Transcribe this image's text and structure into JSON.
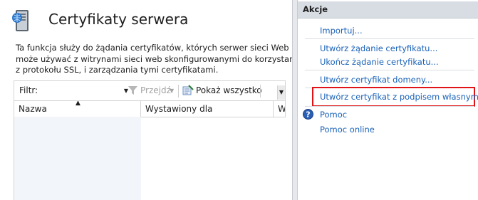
{
  "page": {
    "title": "Certyfikaty serwera",
    "description_lines": [
      "Ta funkcja służy do żądania certyfikatów, których serwer sieci Web",
      "może używać z witrynami sieci web skonfigurowanymi do korzystania",
      "z protokołu SSL, i zarządzania tymi certyfikatami."
    ]
  },
  "filter_bar": {
    "label": "Filtr:",
    "value": "",
    "go_label": "Przejdź",
    "show_all_label": "Pokaż wszystko"
  },
  "grid": {
    "columns": [
      "Nazwa",
      "Wystawiony dla",
      "Wy"
    ],
    "sorted_column": "Nazwa",
    "rows": []
  },
  "actions": {
    "title": "Akcje",
    "groups": [
      [
        "Importuj..."
      ],
      [
        "Utwórz żądanie certyfikatu...",
        "Ukończ żądanie certyfikatu..."
      ],
      [
        "Utwórz certyfikat domeny..."
      ],
      [
        "Utwórz certyfikat z podpisem własnym..."
      ]
    ],
    "help": "Pomoc",
    "help_online": "Pomoc online",
    "highlight_color": "#e01317"
  },
  "icons": {
    "page_icon": "server-certificate-icon",
    "go_icon": "funnel-icon",
    "show_all_icon": "show-all-icon",
    "help_icon": "help-icon"
  },
  "colors": {
    "link": "#1a62b9",
    "actions_header_bg": "#d8dde3",
    "disabled_text": "#a3a3a3"
  }
}
